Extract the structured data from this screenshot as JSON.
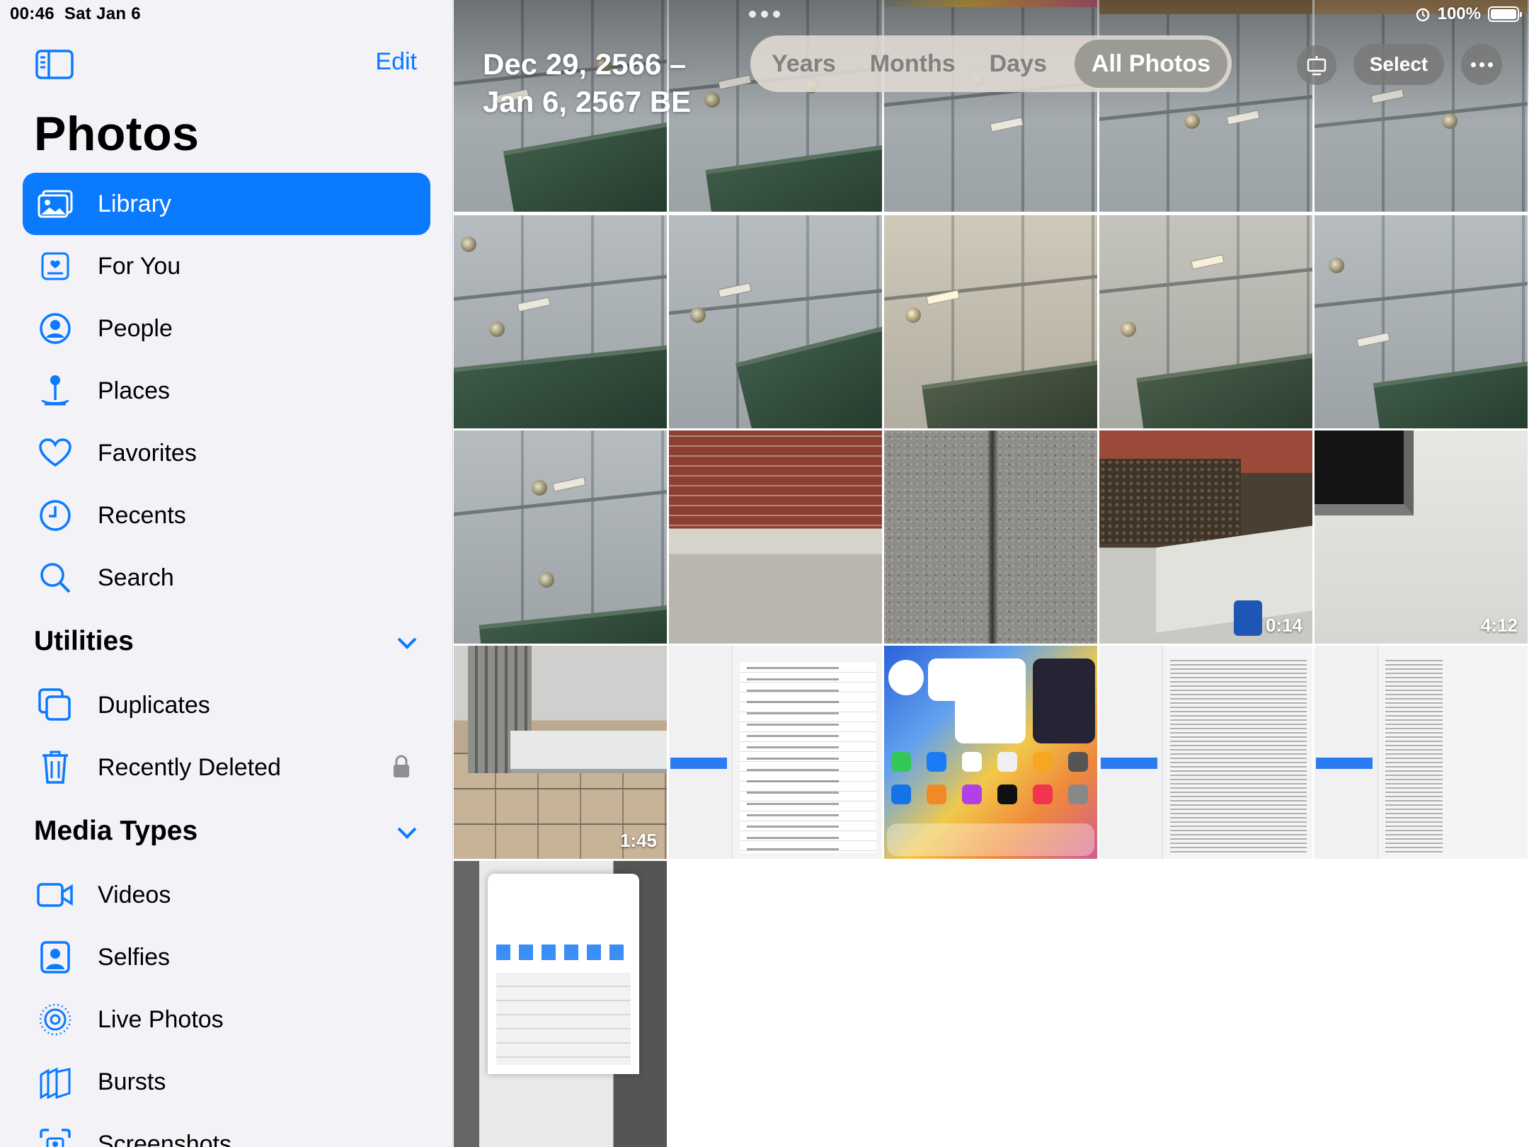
{
  "status_bar": {
    "time": "00:46",
    "date": "Sat Jan 6",
    "battery": "100%"
  },
  "sidebar": {
    "edit_label": "Edit",
    "title": "Photos",
    "items": [
      {
        "label": "Library",
        "icon": "library-icon"
      },
      {
        "label": "For You",
        "icon": "for-you-icon"
      },
      {
        "label": "People",
        "icon": "person-circle-icon"
      },
      {
        "label": "Places",
        "icon": "map-pin-icon"
      },
      {
        "label": "Favorites",
        "icon": "heart-icon"
      },
      {
        "label": "Recents",
        "icon": "clock-icon"
      },
      {
        "label": "Search",
        "icon": "search-icon"
      }
    ],
    "utilities": {
      "header": "Utilities",
      "items": [
        {
          "label": "Duplicates",
          "icon": "duplicates-icon"
        },
        {
          "label": "Recently Deleted",
          "icon": "trash-icon"
        }
      ]
    },
    "media_types": {
      "header": "Media Types",
      "items": [
        {
          "label": "Videos",
          "icon": "video-icon"
        },
        {
          "label": "Selfies",
          "icon": "selfie-icon"
        },
        {
          "label": "Live Photos",
          "icon": "live-photo-icon"
        },
        {
          "label": "Bursts",
          "icon": "bursts-icon"
        },
        {
          "label": "Screenshots",
          "icon": "screenshot-icon"
        }
      ]
    }
  },
  "grid_header": {
    "date_line1": "Dec 29, 2566 –",
    "date_line2": "Jan 6, 2567 BE",
    "segments": [
      "Years",
      "Months",
      "Days",
      "All Photos"
    ],
    "active_segment": "All Photos",
    "select_label": "Select"
  },
  "durations": {
    "tile_14": "0:14",
    "tile_15": "4:12",
    "tile_16": "1:45"
  },
  "colors": {
    "accent": "#0a7aff",
    "sidebar_bg": "#f2f2f7"
  }
}
